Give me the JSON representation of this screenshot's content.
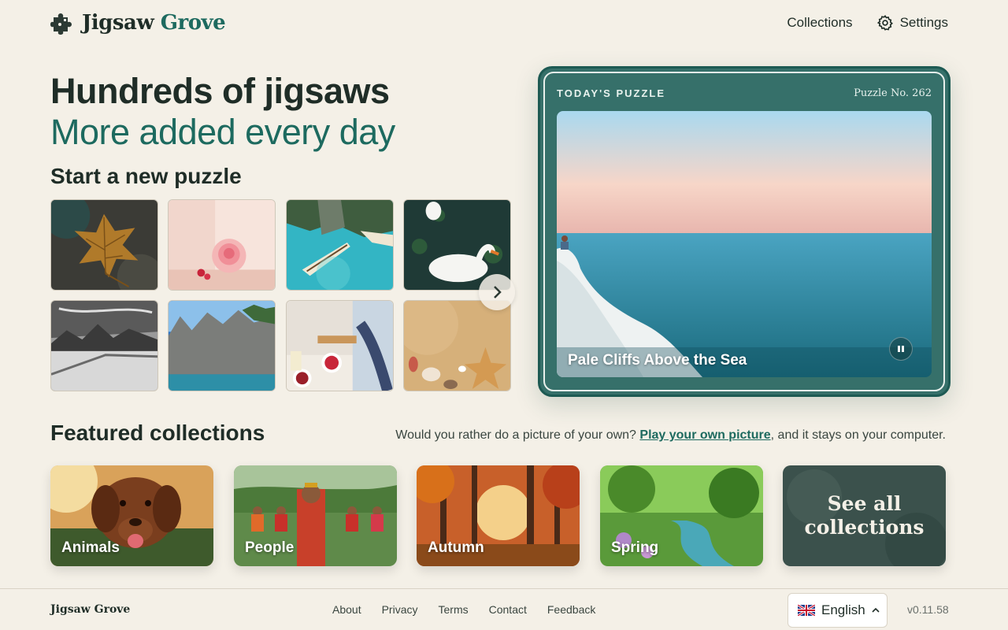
{
  "header": {
    "brand_main": "Jigsaw",
    "brand_accent": "Grove",
    "nav": {
      "collections": "Collections",
      "settings": "Settings"
    }
  },
  "hero": {
    "title": "Hundreds of jigsaws",
    "subtitle": "More added every day",
    "start_title": "Start a new puzzle"
  },
  "thumbnails": [
    {
      "icon": "autumn-leaf"
    },
    {
      "icon": "pink-rose"
    },
    {
      "icon": "canoe-lagoon"
    },
    {
      "icon": "swans"
    },
    {
      "icon": "mountain-bw"
    },
    {
      "icon": "rocky-island"
    },
    {
      "icon": "kitchen-cooking"
    },
    {
      "icon": "seashells-sand"
    }
  ],
  "today": {
    "label": "TODAY'S PUZZLE",
    "number": "Puzzle No. 262",
    "caption": "Pale Cliffs Above the Sea"
  },
  "featured": {
    "title": "Featured collections",
    "own_prefix": "Would you rather do a picture of your own?",
    "own_link": "Play your own picture",
    "own_suffix": ", and it stays on your computer.",
    "collections": [
      {
        "label": "Animals"
      },
      {
        "label": "People"
      },
      {
        "label": "Autumn"
      },
      {
        "label": "Spring"
      }
    ],
    "see_all": "See all collections"
  },
  "footer": {
    "brand": "Jigsaw Grove",
    "links": [
      "About",
      "Privacy",
      "Terms",
      "Contact",
      "Feedback"
    ],
    "language": "English",
    "version": "v0.11.58"
  },
  "colors": {
    "background": "#f4f0e7",
    "accent": "#1d6a5f",
    "card": "#36706a"
  }
}
